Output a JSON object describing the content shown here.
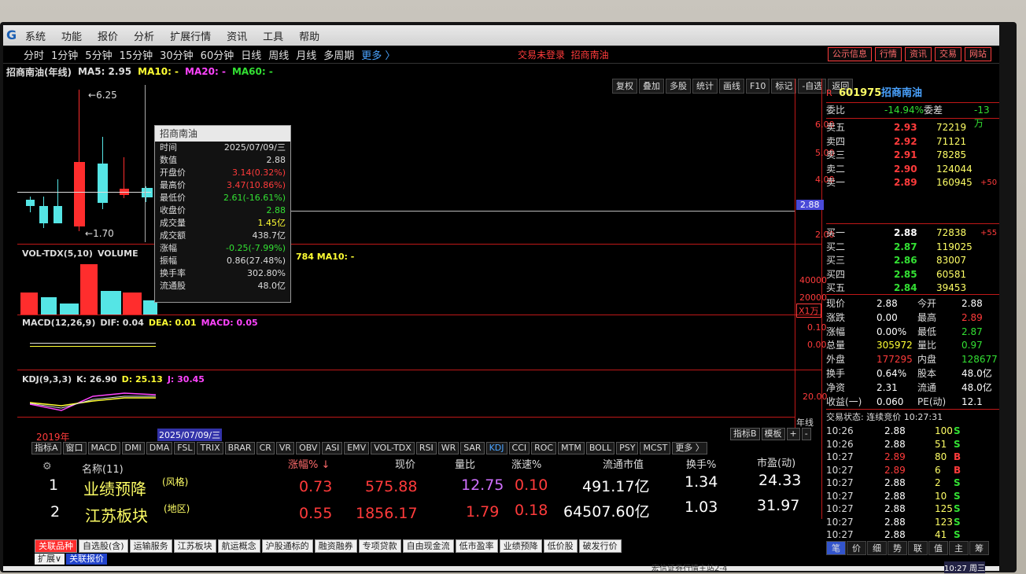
{
  "menu": {
    "items": [
      "系统",
      "功能",
      "报价",
      "分析",
      "扩展行情",
      "资讯",
      "工具",
      "帮助"
    ]
  },
  "periods": {
    "items": [
      "分时",
      "1分钟",
      "5分钟",
      "15分钟",
      "30分钟",
      "60分钟",
      "日线",
      "周线",
      "月线",
      "多周期"
    ],
    "more": "更多 〉"
  },
  "status": {
    "login": "交易未登录",
    "stock": "招商南油"
  },
  "top_buttons": [
    "公示信息",
    "行情",
    "资讯",
    "交易",
    "网站"
  ],
  "chart": {
    "title": "招商南油(年线)",
    "ma5": "MA5: 2.95",
    "ma10": "MA10: -",
    "ma20": "MA20: -",
    "ma60": "MA60: -",
    "high_label": "6.25",
    "low_label": "1.70",
    "price_axis": [
      "6.00",
      "5.00",
      "4.00",
      "2.00"
    ],
    "current_tag": "2.88",
    "vol_axis": [
      "40000",
      "20000"
    ],
    "vol_unit": "X1万",
    "macd_axis": [
      "0.10",
      "0.00"
    ],
    "kdj_axis": [
      "20.00"
    ],
    "year_start": "2019年",
    "date_cursor": "2025/07/09/三",
    "axis_period": "年线",
    "colors": {
      "up": "#ff2d2d",
      "down": "#55e5e5",
      "grid": "#c01818"
    }
  },
  "toolrow": [
    "复权",
    "叠加",
    "多股",
    "统计",
    "画线",
    "F10",
    "标记",
    "-自选",
    "返回"
  ],
  "vol_panel": {
    "name": "VOL-TDX(5,10)",
    "volume_label": "VOLUME",
    "tail": "784 MA10: -"
  },
  "macd_panel": {
    "name": "MACD(12,26,9)",
    "dif": "DIF: 0.04",
    "dea": "DEA: 0.01",
    "macd": "MACD: 0.05"
  },
  "kdj_panel": {
    "name": "KDJ(9,3,3)",
    "k": "K: 26.90",
    "d": "D: 25.13",
    "j": "J: 30.45"
  },
  "tooltip": {
    "title": "招商南油",
    "rows": [
      {
        "k": "时间",
        "v": "2025/07/09/三",
        "c": "#dddddd"
      },
      {
        "k": "数值",
        "v": "2.88",
        "c": "#dddddd"
      },
      {
        "k": "开盘价",
        "v": "3.14(0.32%)",
        "c": "#ff3b3b"
      },
      {
        "k": "最高价",
        "v": "3.47(10.86%)",
        "c": "#ff3b3b"
      },
      {
        "k": "最低价",
        "v": "2.61(-16.61%)",
        "c": "#33e033"
      },
      {
        "k": "收盘价",
        "v": "2.88",
        "c": "#33e033"
      },
      {
        "k": "成交量",
        "v": "1.45亿",
        "c": "#ffff33"
      },
      {
        "k": "成交额",
        "v": "438.7亿",
        "c": "#dddddd"
      },
      {
        "k": "涨幅",
        "v": "-0.25(-7.99%)",
        "c": "#33e033"
      },
      {
        "k": "振幅",
        "v": "0.86(27.48%)",
        "c": "#dddddd"
      },
      {
        "k": "换手率",
        "v": "302.80%",
        "c": "#dddddd"
      },
      {
        "k": "流通股",
        "v": "48.0亿",
        "c": "#dddddd"
      }
    ]
  },
  "indicators": [
    "指标A",
    "窗口",
    "MACD",
    "DMI",
    "DMA",
    "FSL",
    "TRIX",
    "BRAR",
    "CR",
    "VR",
    "OBV",
    "ASI",
    "EMV",
    "VOL-TDX",
    "RSI",
    "WR",
    "SAR",
    "KDJ",
    "CCI",
    "ROC",
    "MTM",
    "BOLL",
    "PSY",
    "MCST",
    "更多 〉"
  ],
  "indicator_right": [
    "指标B",
    "模板",
    "+",
    "-"
  ],
  "table": {
    "headers": {
      "name": "名称(11)",
      "chg": "涨幅% ↓",
      "price": "现价",
      "vr": "量比",
      "speed": "涨速%",
      "mcap": "流通市值",
      "turn": "换手%",
      "pe": "市盈(动)"
    },
    "rows": [
      {
        "idx": "1",
        "name": "业绩预降",
        "tag": "(风格)",
        "chg": "0.73",
        "price": "575.88",
        "vr": "12.75",
        "speed": "0.10",
        "mcap": "491.17亿",
        "turn": "1.34",
        "pe": "24.33"
      },
      {
        "idx": "2",
        "name": "江苏板块",
        "tag": "(地区)",
        "chg": "0.55",
        "price": "1856.17",
        "vr": "1.79",
        "speed": "0.18",
        "mcap": "64507.60亿",
        "turn": "1.03",
        "pe": "31.97"
      }
    ]
  },
  "bottom_tabs": [
    "关联品种",
    "自选股(含)",
    "运输服务",
    "江苏板块",
    "航运概念",
    "沪股通标的",
    "融资融券",
    "专项贷款",
    "自由现金流",
    "低市盈率",
    "业绩预降",
    "低价股",
    "破发行价"
  ],
  "bottom2": [
    "扩展∨",
    "关联报价"
  ],
  "quote": {
    "code": "601975",
    "name": "招商南油",
    "weibi_label": "委比",
    "weibi": "-14.94%",
    "weicha_label": "委差",
    "weicha": "-13万",
    "asks": [
      {
        "lvl": "卖五",
        "p": "2.93",
        "v": "72219",
        "chg": ""
      },
      {
        "lvl": "卖四",
        "p": "2.92",
        "v": "71121",
        "chg": ""
      },
      {
        "lvl": "卖三",
        "p": "2.91",
        "v": "78285",
        "chg": ""
      },
      {
        "lvl": "卖二",
        "p": "2.90",
        "v": "124044",
        "chg": ""
      },
      {
        "lvl": "卖一",
        "p": "2.89",
        "v": "160945",
        "chg": "+50"
      }
    ],
    "bids": [
      {
        "lvl": "买一",
        "p": "2.88",
        "v": "72838",
        "chg": "+55"
      },
      {
        "lvl": "买二",
        "p": "2.87",
        "v": "119025",
        "chg": ""
      },
      {
        "lvl": "买三",
        "p": "2.86",
        "v": "83007",
        "chg": ""
      },
      {
        "lvl": "买四",
        "p": "2.85",
        "v": "60581",
        "chg": ""
      },
      {
        "lvl": "买五",
        "p": "2.84",
        "v": "39453",
        "chg": ""
      }
    ],
    "stats": [
      {
        "l1": "现价",
        "v1": "2.88",
        "l2": "今开",
        "v2": "2.88",
        "c1": "#ffffff",
        "c2": "#ffffff"
      },
      {
        "l1": "涨跌",
        "v1": "0.00",
        "l2": "最高",
        "v2": "2.89",
        "c1": "#ffffff",
        "c2": "#ff3b3b"
      },
      {
        "l1": "涨幅",
        "v1": "0.00%",
        "l2": "最低",
        "v2": "2.87",
        "c1": "#ffffff",
        "c2": "#33e033"
      },
      {
        "l1": "总量",
        "v1": "305972",
        "l2": "量比",
        "v2": "0.97",
        "c1": "#ffff33",
        "c2": "#33e033"
      },
      {
        "l1": "外盘",
        "v1": "177295",
        "l2": "内盘",
        "v2": "128677",
        "c1": "#ff3b3b",
        "c2": "#33e033"
      },
      {
        "l1": "换手",
        "v1": "0.64%",
        "l2": "股本",
        "v2": "48.0亿",
        "c1": "#ffffff",
        "c2": "#ffffff"
      },
      {
        "l1": "净资",
        "v1": "2.31",
        "l2": "流通",
        "v2": "48.0亿",
        "c1": "#ffffff",
        "c2": "#ffffff"
      },
      {
        "l1": "收益(一)",
        "v1": "0.060",
        "l2": "PE(动)",
        "v2": "12.1",
        "c1": "#ffffff",
        "c2": "#ffffff"
      }
    ],
    "trade_status": "交易状态: 连续竞价 10:27:31",
    "ticks": [
      {
        "t": "10:26",
        "p": "2.88",
        "v": "100",
        "s": "S",
        "pc": "#ffffff",
        "sc": "#33e033"
      },
      {
        "t": "10:26",
        "p": "2.88",
        "v": "51",
        "s": "S",
        "pc": "#ffffff",
        "sc": "#33e033"
      },
      {
        "t": "10:27",
        "p": "2.89",
        "v": "80",
        "s": "B",
        "pc": "#ff3b3b",
        "sc": "#ff3b3b"
      },
      {
        "t": "10:27",
        "p": "2.89",
        "v": "6",
        "s": "B",
        "pc": "#ff3b3b",
        "sc": "#ff3b3b"
      },
      {
        "t": "10:27",
        "p": "2.88",
        "v": "2",
        "s": "S",
        "pc": "#ffffff",
        "sc": "#33e033"
      },
      {
        "t": "10:27",
        "p": "2.88",
        "v": "10",
        "s": "S",
        "pc": "#ffffff",
        "sc": "#33e033"
      },
      {
        "t": "10:27",
        "p": "2.88",
        "v": "125",
        "s": "S",
        "pc": "#ffffff",
        "sc": "#33e033"
      },
      {
        "t": "10:27",
        "p": "2.88",
        "v": "123",
        "s": "S",
        "pc": "#ffffff",
        "sc": "#33e033"
      },
      {
        "t": "10:27",
        "p": "2.88",
        "v": "41",
        "s": "S",
        "pc": "#ffffff",
        "sc": "#33e033"
      }
    ],
    "bottom_tabs": [
      "笔",
      "价",
      "细",
      "势",
      "联",
      "值",
      "主",
      "筹"
    ]
  },
  "system": {
    "server": "宏信证券行情主站2-4",
    "clock": "10:27 周三"
  }
}
